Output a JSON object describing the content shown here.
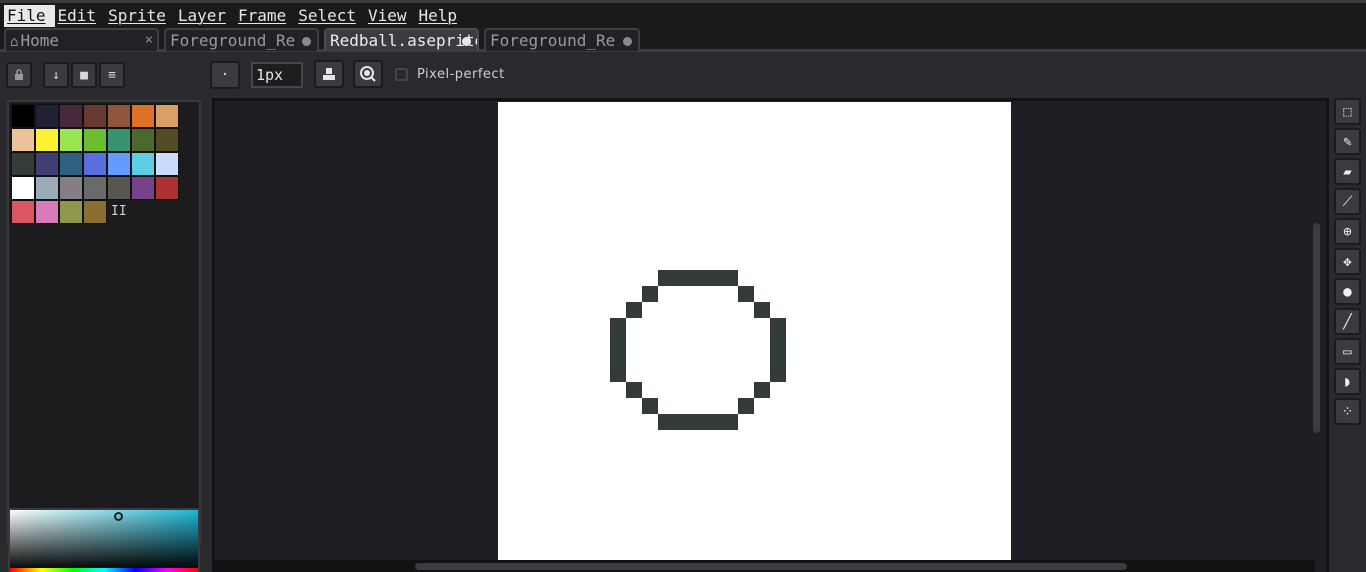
{
  "menubar": {
    "items": [
      "File",
      "Edit",
      "Sprite",
      "Layer",
      "Frame",
      "Select",
      "View",
      "Help"
    ]
  },
  "tabs": [
    {
      "label": "Home",
      "icon": "home-icon",
      "close": "×"
    },
    {
      "label": "Foreground_Re",
      "modified": true
    },
    {
      "label": "Redball.aseprite",
      "modified": true,
      "active": true
    },
    {
      "label": "Foreground_Re",
      "modified": true
    }
  ],
  "layer_buttons": {
    "lock": "lock-icon",
    "down": "↓",
    "new": "■",
    "menu": "≡"
  },
  "palette": {
    "colors": [
      "#000000",
      "#222034",
      "#45283c",
      "#663931",
      "#8f563b",
      "#df7126",
      "#d9a066",
      "#eec39a",
      "#fbf236",
      "#99e550",
      "#6abe30",
      "#37946e",
      "#4b692f",
      "#524b24",
      "#323c39",
      "#3f3f74",
      "#306082",
      "#5b6ee1",
      "#639bff",
      "#5fcde4",
      "#cbdbfc",
      "#ffffff",
      "#9badb7",
      "#847e87",
      "#696a6a",
      "#595652",
      "#76428a",
      "#ac3232",
      "#d95763",
      "#d77bba",
      "#8f974a",
      "#8a6f30"
    ],
    "more_label": "II"
  },
  "context_bar": {
    "brush_type": "·",
    "brush_size": "1px",
    "pixel_perfect_label": "Pixel-perfect",
    "pixel_perfect_checked": false
  },
  "canvas": {
    "background": "#ffffff",
    "ink": "#333b39"
  },
  "tools": [
    "marquee-icon",
    "pencil-icon",
    "eraser-icon",
    "eyedropper-icon",
    "zoom-icon",
    "move-icon",
    "paint-bucket-icon",
    "line-icon",
    "rectangle-icon",
    "blur-icon",
    "spray-icon"
  ]
}
